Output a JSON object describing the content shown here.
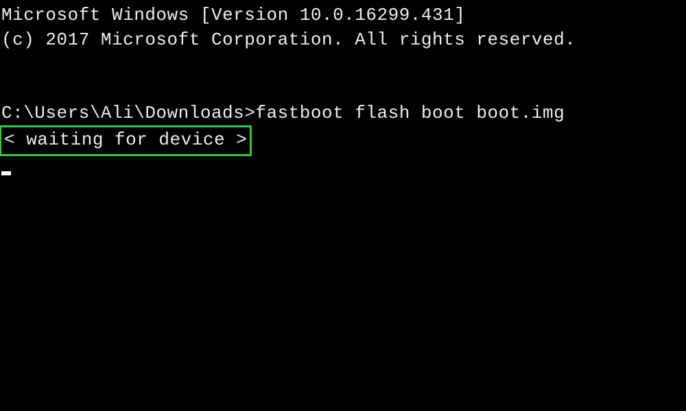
{
  "terminal": {
    "version_line": "Microsoft Windows [Version 10.0.16299.431]",
    "copyright_line": "(c) 2017 Microsoft Corporation. All rights reserved.",
    "prompt": "C:\\Users\\Ali\\Downloads>",
    "command": "fastboot flash boot boot.img",
    "output_line": "< waiting for device >"
  }
}
